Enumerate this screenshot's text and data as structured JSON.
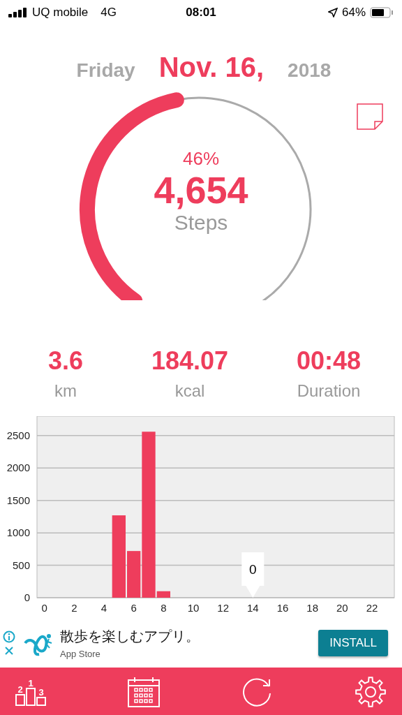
{
  "status_bar": {
    "carrier": "UQ mobile",
    "network": "4G",
    "time": "08:01",
    "battery": "64%"
  },
  "date": {
    "weekday": "Friday",
    "day": "Nov. 16,",
    "year": "2018"
  },
  "progress": {
    "percent": "46%",
    "steps": "4,654",
    "unit": "Steps"
  },
  "stats": [
    {
      "value": "3.6",
      "label": "km"
    },
    {
      "value": "184.07",
      "label": "kcal"
    },
    {
      "value": "00:48",
      "label": "Duration"
    }
  ],
  "chart": {
    "tooltip": "0",
    "chart_data": {
      "type": "bar",
      "x": [
        0,
        1,
        2,
        3,
        4,
        5,
        6,
        7,
        8,
        9,
        10,
        11,
        12,
        13,
        14,
        15,
        16,
        17,
        18,
        19,
        20,
        21,
        22,
        23
      ],
      "series": [
        {
          "color": "#ee3d5c",
          "values": [
            0,
            0,
            0,
            0,
            0,
            1270,
            720,
            2560,
            100,
            0,
            0,
            0,
            0,
            0,
            0,
            0,
            0,
            0,
            0,
            0,
            0,
            0,
            0,
            0
          ]
        }
      ],
      "ylim": [
        0,
        2800
      ],
      "yticks": [
        0,
        500,
        1000,
        1500,
        2000,
        2500
      ],
      "xlim": [
        -0.5,
        23.5
      ],
      "xticks": [
        0,
        2,
        4,
        6,
        8,
        10,
        12,
        14,
        16,
        18,
        20,
        22
      ],
      "grid": true
    }
  },
  "ad": {
    "title": "散歩を楽しむアプリ。",
    "source": "App Store",
    "button": "INSTALL"
  },
  "tab_bar": {
    "podium_ranks": [
      "1",
      "2",
      "3"
    ]
  }
}
